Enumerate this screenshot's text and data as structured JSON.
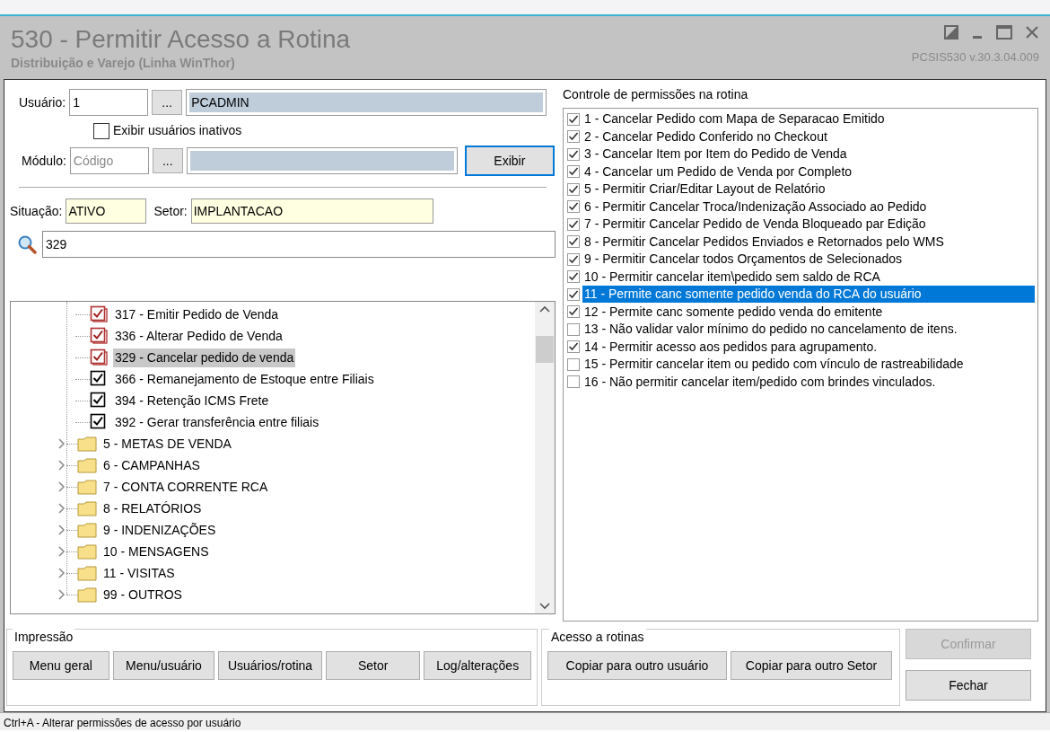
{
  "window": {
    "title": "530 - Permitir Acesso a Rotina",
    "subtitle": "Distribuição e Varejo (Linha WinThor)",
    "version": "PCSIS530  v.30.3.04.009"
  },
  "user": {
    "label": "Usuário:",
    "code": "1",
    "name": "PCADMIN",
    "lookup": "..."
  },
  "show_inactive": {
    "label": "Exibir usuários inativos",
    "checked": false
  },
  "module": {
    "label": "Módulo:",
    "placeholder": "Código",
    "lookup": "...",
    "button": "Exibir"
  },
  "situation": {
    "label": "Situação:",
    "value": "ATIVO"
  },
  "sector": {
    "label": "Setor:",
    "value": "IMPLANTACAO"
  },
  "search": {
    "value": "329"
  },
  "tree": [
    {
      "kind": "routine",
      "label": "317 - Emitir Pedido de Venda",
      "checked": true,
      "linked": true,
      "selected": false
    },
    {
      "kind": "routine",
      "label": "336 - Alterar Pedido de Venda",
      "checked": true,
      "linked": true,
      "selected": false
    },
    {
      "kind": "routine",
      "label": "329 - Cancelar pedido de venda",
      "checked": true,
      "linked": true,
      "selected": true
    },
    {
      "kind": "routine",
      "label": "366 - Remanejamento de Estoque entre Filiais",
      "checked": true,
      "linked": false,
      "selected": false
    },
    {
      "kind": "routine",
      "label": "394 - Retenção ICMS Frete",
      "checked": true,
      "linked": false,
      "selected": false
    },
    {
      "kind": "routine",
      "label": "392 - Gerar transferência entre filiais",
      "checked": true,
      "linked": false,
      "selected": false
    },
    {
      "kind": "folder",
      "label": "5 - METAS DE VENDA",
      "selected": false
    },
    {
      "kind": "folder",
      "label": "6 - CAMPANHAS",
      "selected": false
    },
    {
      "kind": "folder",
      "label": "7 - CONTA CORRENTE RCA",
      "selected": false
    },
    {
      "kind": "folder",
      "label": "8 - RELATÓRIOS",
      "selected": false
    },
    {
      "kind": "folder",
      "label": "9 - INDENIZAÇÕES",
      "selected": false
    },
    {
      "kind": "folder",
      "label": "10 - MENSAGENS",
      "selected": false
    },
    {
      "kind": "folder",
      "label": "11 - VISITAS",
      "selected": false
    },
    {
      "kind": "folder",
      "label": "99 - OUTROS",
      "selected": false
    }
  ],
  "permissions": {
    "title": "Controle de permissões na rotina",
    "items": [
      {
        "label": "1 - Cancelar Pedido com Mapa de Separacao Emitido",
        "checked": true,
        "selected": false
      },
      {
        "label": "2 - Cancelar Pedido Conferido no Checkout",
        "checked": true,
        "selected": false
      },
      {
        "label": "3 - Cancelar Item por Item do Pedido de Venda",
        "checked": true,
        "selected": false
      },
      {
        "label": "4 - Cancelar um Pedido de Venda por Completo",
        "checked": true,
        "selected": false
      },
      {
        "label": "5 - Permitir Criar/Editar Layout de Relatório",
        "checked": true,
        "selected": false
      },
      {
        "label": "6 - Permitir Cancelar Troca/Indenização Associado ao Pedido",
        "checked": true,
        "selected": false
      },
      {
        "label": "7 - Permitir Cancelar Pedido de Venda Bloqueado par Edição",
        "checked": true,
        "selected": false
      },
      {
        "label": "8 - Permitir Cancelar Pedidos Enviados e Retornados pelo WMS",
        "checked": true,
        "selected": false
      },
      {
        "label": "9 - Permitir Cancelar todos Orçamentos de Selecionados",
        "checked": true,
        "selected": false
      },
      {
        "label": "10 - Permitir cancelar item\\pedido sem saldo de RCA",
        "checked": true,
        "selected": false
      },
      {
        "label": "11 - Permite canc somente pedido venda do RCA do usuário",
        "checked": true,
        "selected": true
      },
      {
        "label": "12 - Permite canc somente pedido venda do emitente",
        "checked": true,
        "selected": false
      },
      {
        "label": "13 - Não validar valor mínimo do pedido no cancelamento de itens.",
        "checked": false,
        "selected": false
      },
      {
        "label": "14 - Permitir acesso aos pedidos para agrupamento.",
        "checked": true,
        "selected": false
      },
      {
        "label": "15 - Permitir cancelar item ou pedido com vínculo de rastreabilidade",
        "checked": false,
        "selected": false
      },
      {
        "label": "16 - Não permitir cancelar item/pedido com brindes vinculados.",
        "checked": false,
        "selected": false
      }
    ]
  },
  "print_group": {
    "title": "Impressão",
    "buttons": [
      "Menu geral",
      "Menu/usuário",
      "Usuários/rotina",
      "Setor",
      "Log/alterações"
    ]
  },
  "access_group": {
    "title": "Acesso a rotinas",
    "buttons": [
      "Copiar para outro usuário",
      "Copiar para outro Setor"
    ]
  },
  "actions": [
    {
      "label": "Confirmar",
      "disabled": true
    },
    {
      "label": "Fechar",
      "disabled": false
    }
  ],
  "status_bar": "Ctrl+A - Alterar permissões de acesso por usuário"
}
